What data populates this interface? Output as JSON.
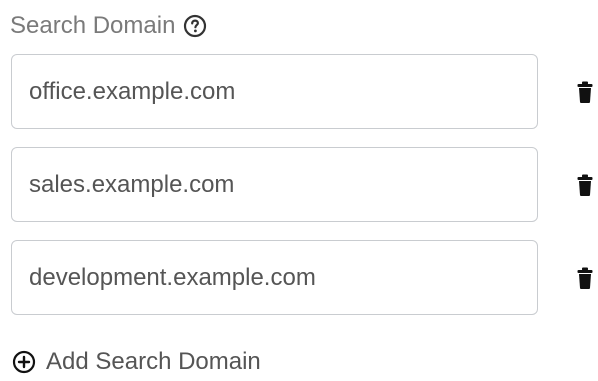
{
  "label": {
    "text": "Search Domain",
    "help_icon": "question-circle-icon"
  },
  "domains": [
    {
      "value": "office.example.com",
      "delete_icon": "trash-icon"
    },
    {
      "value": "sales.example.com",
      "delete_icon": "trash-icon"
    },
    {
      "value": "development.example.com",
      "delete_icon": "trash-icon"
    }
  ],
  "add_action": {
    "label": "Add Search Domain",
    "icon": "plus-circle-icon"
  },
  "colors": {
    "label_text": "#7a7a7a",
    "input_border": "#c9ccd0",
    "input_text": "#555555",
    "icon": "#111111"
  }
}
